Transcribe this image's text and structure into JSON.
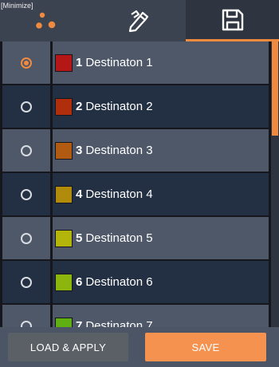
{
  "minimize_label": "[Minimize]",
  "tabs": [
    {
      "icon": "nodes-icon",
      "active": false
    },
    {
      "icon": "edit-icon",
      "active": false
    },
    {
      "icon": "save-disk-icon",
      "active": true
    }
  ],
  "destinations": [
    {
      "number": "1",
      "name": "Destinaton 1",
      "color": "#b51716",
      "selected": true
    },
    {
      "number": "2",
      "name": "Destinaton 2",
      "color": "#b12e0d",
      "selected": false
    },
    {
      "number": "3",
      "name": "Destinaton 3",
      "color": "#b05a12",
      "selected": false
    },
    {
      "number": "4",
      "name": "Destinaton 4",
      "color": "#b08b0c",
      "selected": false
    },
    {
      "number": "5",
      "name": "Destinaton 5",
      "color": "#b3b50b",
      "selected": false
    },
    {
      "number": "6",
      "name": "Destinaton 6",
      "color": "#8cb50d",
      "selected": false
    },
    {
      "number": "7",
      "name": "Destinaton 7",
      "color": "#5fae12",
      "selected": false
    }
  ],
  "footer": {
    "load_label": "LOAD & APPLY",
    "save_label": "SAVE"
  },
  "colors": {
    "accent": "#f08a3e",
    "row_light": "#4f5869",
    "row_dark": "#233043"
  }
}
